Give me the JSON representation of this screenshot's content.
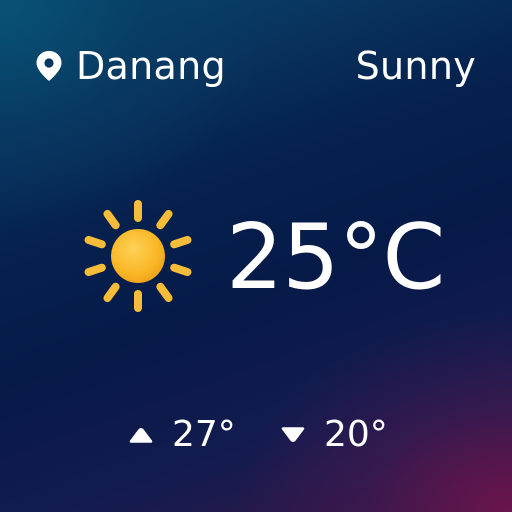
{
  "location": {
    "city": "Danang",
    "icon": "map-pin-icon"
  },
  "current": {
    "condition": "Sunny",
    "temperature": "25°C",
    "icon": "sun-icon"
  },
  "range": {
    "high": "27°",
    "high_icon": "triangle-up-icon",
    "low": "20°",
    "low_icon": "triangle-down-icon"
  },
  "colors": {
    "sun_core": "#f9b625",
    "sun_rays": "#f7bd3a",
    "text": "#ffffff",
    "bg_top_left": "#0a4a70",
    "bg_middle": "#061a48",
    "bg_bottom_right": "#6e144b"
  }
}
